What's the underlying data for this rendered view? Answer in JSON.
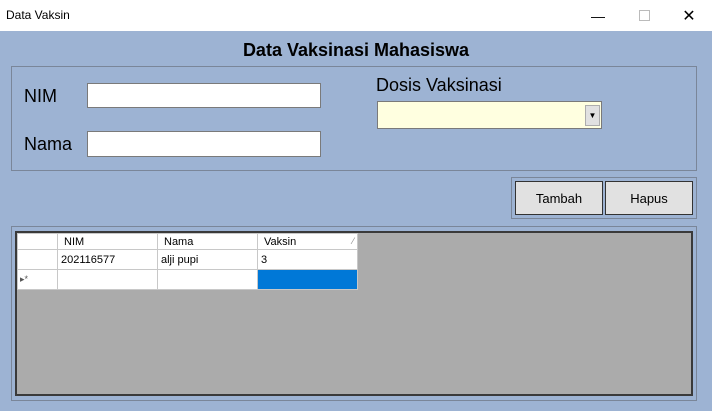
{
  "window": {
    "title": "Data Vaksin"
  },
  "header": {
    "title": "Data Vaksinasi Mahasiswa"
  },
  "form": {
    "nim_label": "NIM",
    "nim_value": "",
    "nama_label": "Nama",
    "nama_value": "",
    "dosis_label": "Dosis Vaksinasi",
    "dosis_value": ""
  },
  "buttons": {
    "tambah": "Tambah",
    "hapus": "Hapus"
  },
  "grid": {
    "columns": [
      "NIM",
      "Nama",
      "Vaksin"
    ],
    "rows": [
      {
        "nim": "202116577",
        "nama": "alji pupi",
        "vaksin": "3"
      }
    ],
    "new_row_marker": "▸*"
  },
  "colors": {
    "background": "#9db3d3",
    "combo": "#ffffe0",
    "selection": "#0078d7",
    "grid_bg": "#ababab"
  }
}
